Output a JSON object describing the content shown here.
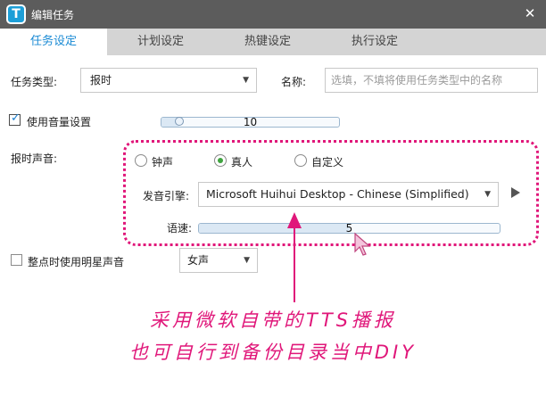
{
  "window": {
    "app_logo_letter": "T",
    "title": "编辑任务",
    "close_label": "✕"
  },
  "tabs": [
    {
      "label": "任务设定",
      "active": true
    },
    {
      "label": "计划设定",
      "active": false
    },
    {
      "label": "热键设定",
      "active": false
    },
    {
      "label": "执行设定",
      "active": false
    }
  ],
  "form": {
    "task_type_label": "任务类型:",
    "task_type_value": "报时",
    "name_label": "名称:",
    "name_placeholder": "选填，不填将使用任务类型中的名称",
    "name_value": "",
    "use_volume_label": "使用音量设置",
    "use_volume_checked": true,
    "volume_value": "10",
    "volume_level_pct": 10,
    "announce_sound_label": "报时声音:",
    "sound_options": [
      {
        "label": "钟声",
        "selected": false
      },
      {
        "label": "真人",
        "selected": true
      },
      {
        "label": "自定义",
        "selected": false
      }
    ],
    "engine_label": "发音引擎:",
    "engine_value": "Microsoft Huihui Desktop - Chinese (Simplified)",
    "speed_label": "语速:",
    "speed_value": "5",
    "speed_level_pct": 50,
    "star_voice_label": "整点时使用明星声音",
    "star_voice_checked": false,
    "star_voice_value": "女声"
  },
  "annotation": {
    "line1": "采用微软自带的TTS播报",
    "line2": "也可自行到备份目录当中DIY"
  },
  "colors": {
    "accent": "#1a8ad4",
    "highlight": "#e0177a",
    "titlebar": "#5c5c5c",
    "tabbar": "#d4d4d4"
  },
  "icons": [
    "app-logo",
    "close-icon",
    "dropdown-caret-icon",
    "check-icon",
    "play-icon",
    "mouse-cursor-icon",
    "annotation-arrow-icon"
  ]
}
